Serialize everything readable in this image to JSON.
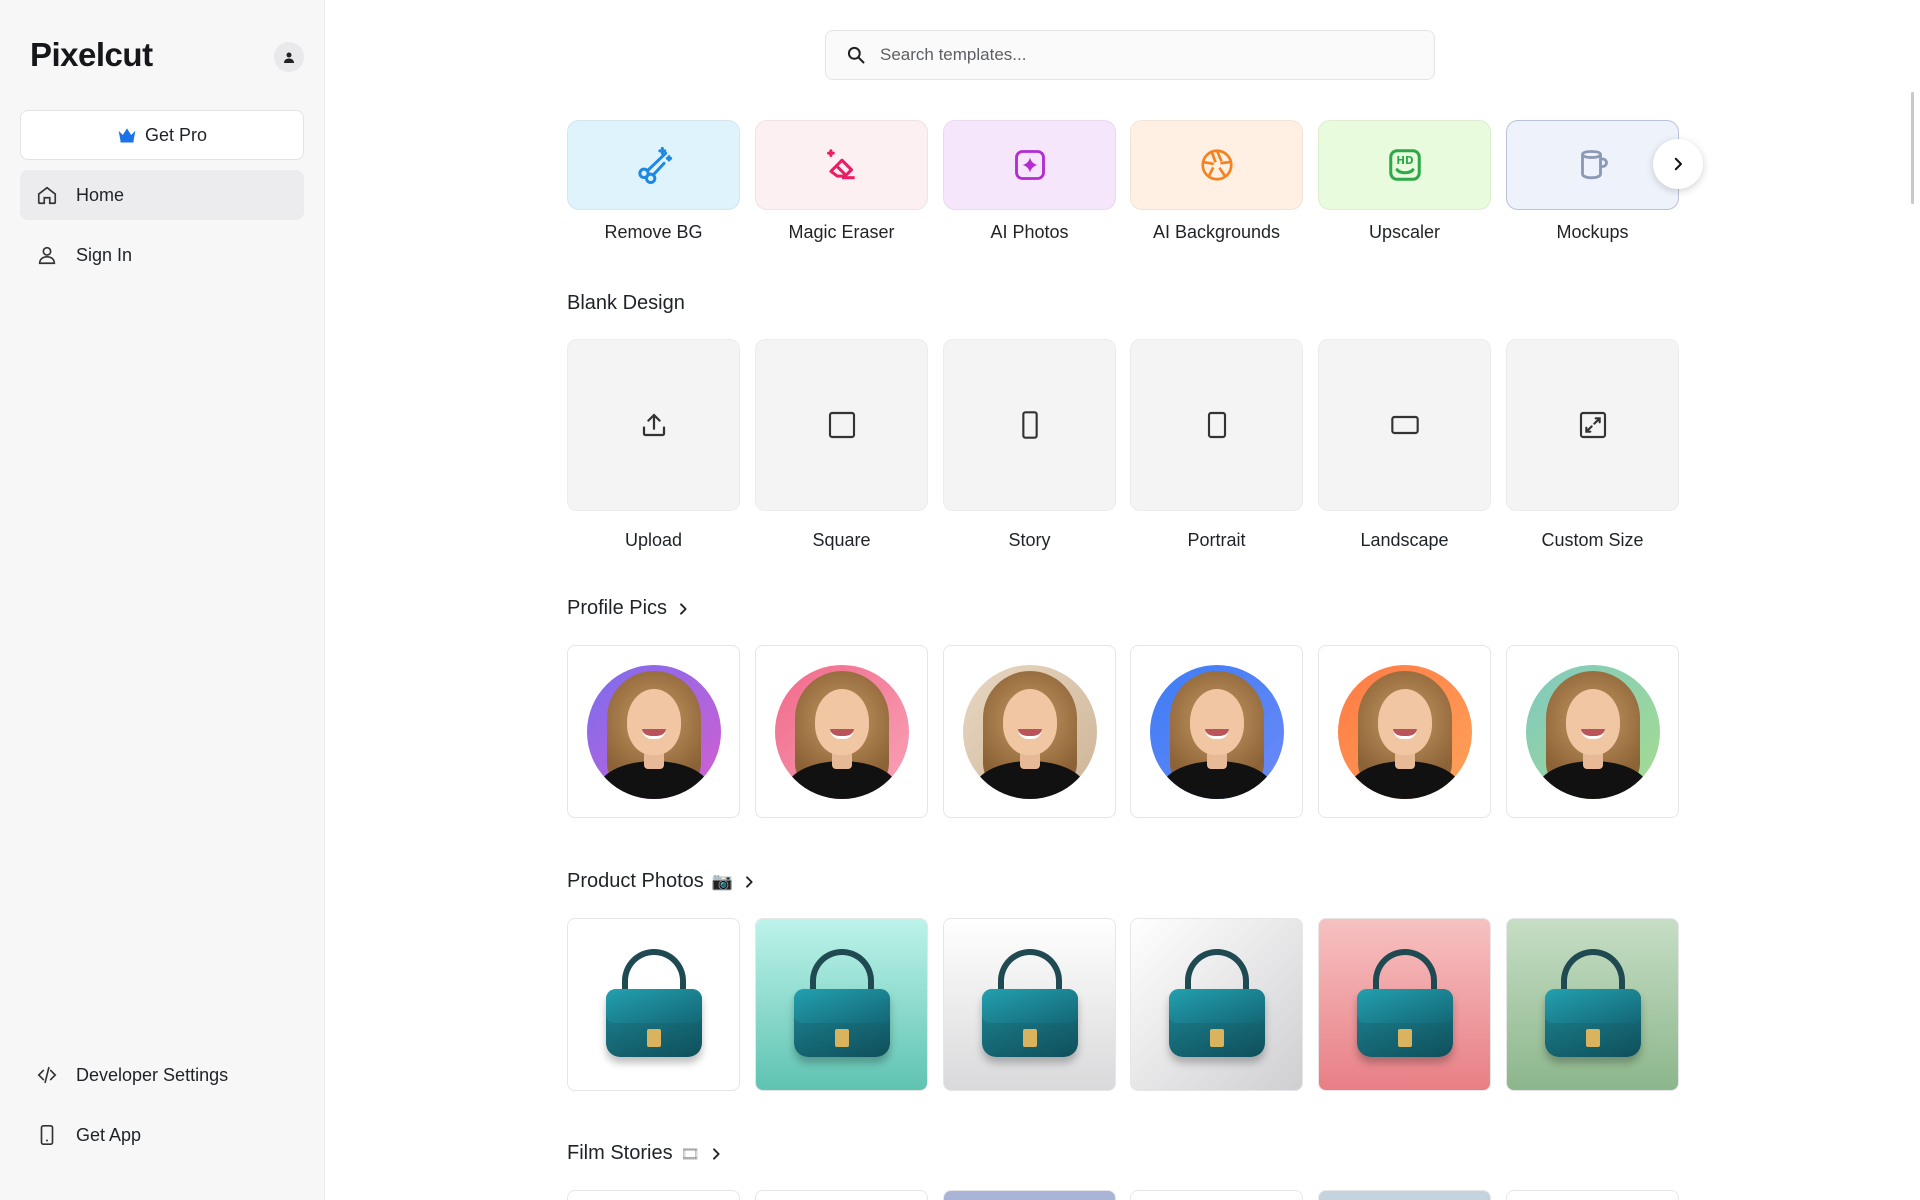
{
  "app": {
    "name": "Pixelcut"
  },
  "sidebar": {
    "get_pro": "Get Pro",
    "nav": [
      {
        "label": "Home",
        "icon": "home-icon",
        "active": true
      },
      {
        "label": "Sign In",
        "icon": "user-icon",
        "active": false
      }
    ],
    "bottom": [
      {
        "label": "Developer Settings",
        "icon": "code-icon"
      },
      {
        "label": "Get App",
        "icon": "phone-icon"
      }
    ]
  },
  "search": {
    "placeholder": "Search templates..."
  },
  "tools": [
    {
      "label": "Remove BG",
      "icon": "scissors-sparkle-icon",
      "bg": "#dff3fd",
      "color": "#1e88e5"
    },
    {
      "label": "Magic Eraser",
      "icon": "eraser-icon",
      "bg": "#fdf0f3",
      "color": "#e91e63"
    },
    {
      "label": "AI Photos",
      "icon": "sparkle-square-icon",
      "bg": "#f6e6fc",
      "color": "#b32bd1"
    },
    {
      "label": "AI Backgrounds",
      "icon": "aperture-icon",
      "bg": "#fff0e3",
      "color": "#f58220"
    },
    {
      "label": "Upscaler",
      "icon": "hd-icon",
      "bg": "#e8fbdc",
      "color": "#2ea84a"
    },
    {
      "label": "Mockups",
      "icon": "mug-icon",
      "bg": "#eef2fb",
      "color": "#8b99b7"
    }
  ],
  "blank_design": {
    "title": "Blank Design",
    "items": [
      {
        "label": "Upload",
        "icon": "upload-icon"
      },
      {
        "label": "Square",
        "icon": "square-icon"
      },
      {
        "label": "Story",
        "icon": "story-icon"
      },
      {
        "label": "Portrait",
        "icon": "portrait-icon"
      },
      {
        "label": "Landscape",
        "icon": "landscape-icon"
      },
      {
        "label": "Custom Size",
        "icon": "resize-icon"
      }
    ]
  },
  "profile_pics": {
    "title": "Profile Pics",
    "items": [
      {
        "bg1": "#7b6cf0",
        "bg2": "#d45fd0"
      },
      {
        "bg1": "#f06a8a",
        "bg2": "#f9a3b8"
      },
      {
        "bg1": "#e8d7c2",
        "bg2": "#cdb497"
      },
      {
        "bg1": "#3d7cf5",
        "bg2": "#6d8af7"
      },
      {
        "bg1": "#ff7a45",
        "bg2": "#ffa35a"
      },
      {
        "bg1": "#7fc8c0",
        "bg2": "#a6dd8f"
      }
    ]
  },
  "product_photos": {
    "title": "Product Photos",
    "emoji": "📷",
    "items": [
      {
        "bg": "#ffffff"
      },
      {
        "bg": "linear-gradient(180deg,#bdf3ea,#5fc3b2)"
      },
      {
        "bg": "linear-gradient(180deg,#ffffff,#d9d9db)"
      },
      {
        "bg": "linear-gradient(135deg,#ffffff,#cfcfd2)"
      },
      {
        "bg": "linear-gradient(180deg,#f7c1c1,#e87f85)"
      },
      {
        "bg": "linear-gradient(180deg,#c6dec5,#8cb68b)"
      }
    ]
  },
  "film_stories": {
    "title": "Film Stories",
    "emoji": "🎞"
  }
}
